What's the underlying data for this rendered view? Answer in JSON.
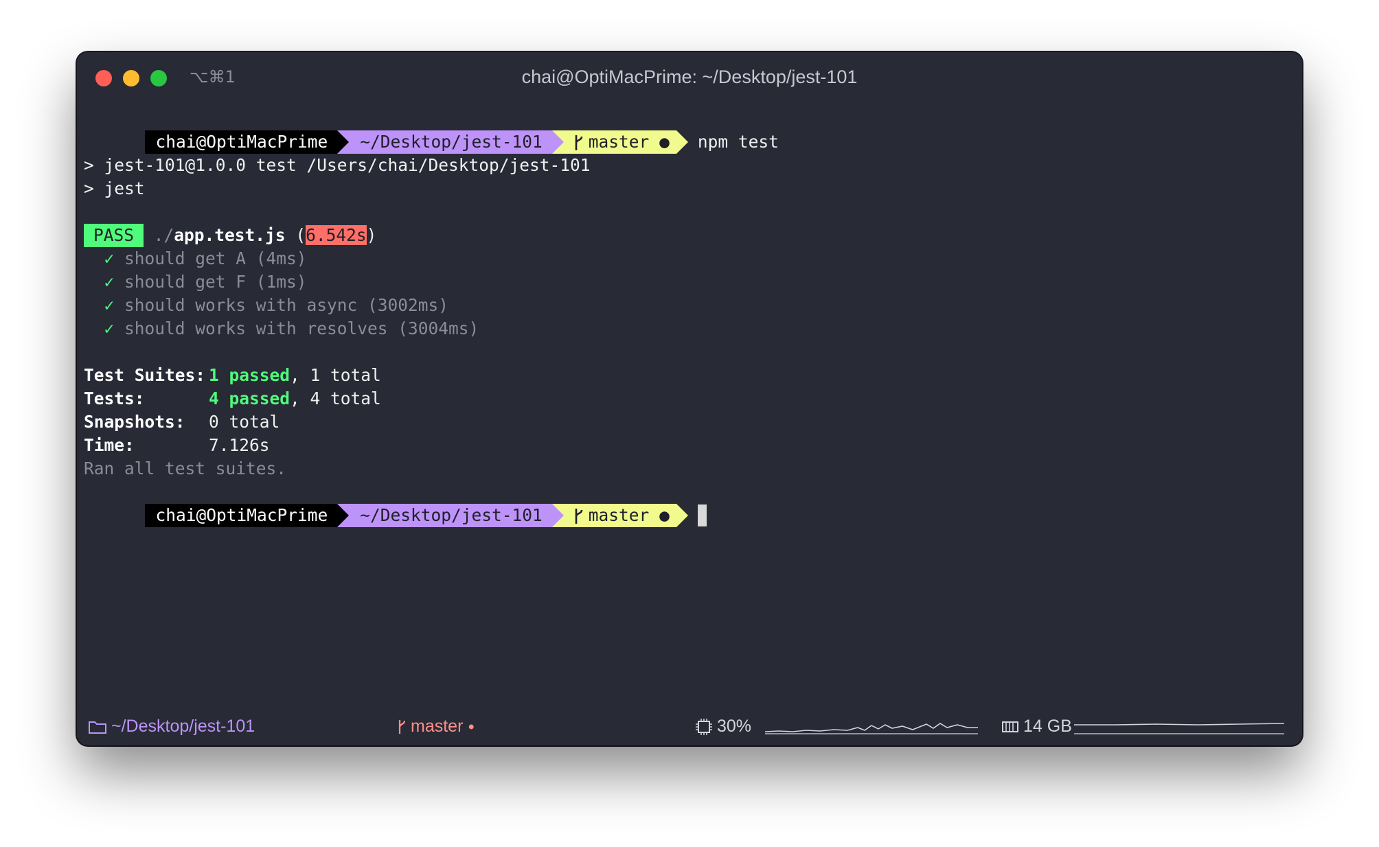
{
  "window": {
    "shortcut": "⌥⌘1",
    "title": "chai@OptiMacPrime: ~/Desktop/jest-101"
  },
  "prompt": {
    "user": "chai@OptiMacPrime",
    "path": "~/Desktop/jest-101",
    "branch": "master",
    "dirty_dot": "●",
    "command": "npm test"
  },
  "output": {
    "script_line1": "> jest-101@1.0.0 test /Users/chai/Desktop/jest-101",
    "script_line2": "> jest",
    "pass_label": "PASS",
    "file_dir": "./",
    "file_name": "app.test.js",
    "file_time": "6.542s",
    "tests": [
      {
        "check": "✓",
        "text": "should get A (4ms)"
      },
      {
        "check": "✓",
        "text": "should get F (1ms)"
      },
      {
        "check": "✓",
        "text": "should works with async (3002ms)"
      },
      {
        "check": "✓",
        "text": "should works with resolves (3004ms)"
      }
    ],
    "summary": {
      "suites_label": "Test Suites:",
      "suites_passed": "1 passed",
      "suites_total": "1 total",
      "tests_label": "Tests:",
      "tests_passed": "4 passed",
      "tests_total": "4 total",
      "snapshots_label": "Snapshots:",
      "snapshots_total": "0 total",
      "time_label": "Time:",
      "time_value": "7.126s",
      "ran_all": "Ran all test suites."
    }
  },
  "statusbar": {
    "path": "~/Desktop/jest-101",
    "branch": "master",
    "branch_dot": "●",
    "cpu": "30%",
    "memory": "14 GB"
  },
  "colors": {
    "background": "#282a36",
    "purple": "#bd93f9",
    "yellow": "#f1fa8c",
    "green": "#50fa7b",
    "red": "#ff6e67"
  }
}
